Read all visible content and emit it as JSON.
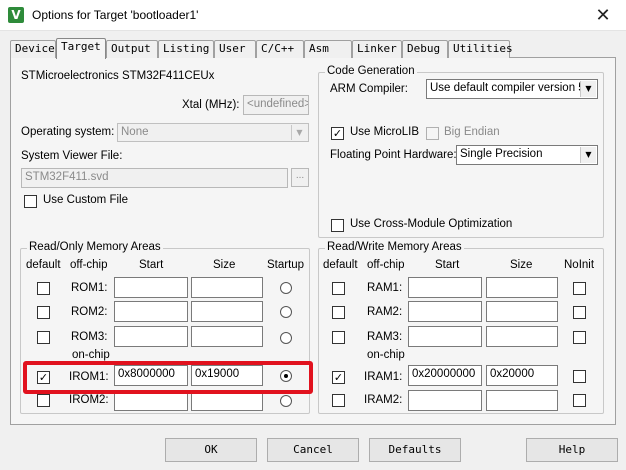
{
  "window": {
    "title": "Options for Target 'bootloader1'",
    "app_icon_glyph": "V",
    "close_glyph": "✕"
  },
  "tabs": [
    {
      "label": "Device"
    },
    {
      "label": "Target"
    },
    {
      "label": "Output"
    },
    {
      "label": "Listing"
    },
    {
      "label": "User"
    },
    {
      "label": "C/C++"
    },
    {
      "label": "Asm"
    },
    {
      "label": "Linker"
    },
    {
      "label": "Debug"
    },
    {
      "label": "Utilities"
    }
  ],
  "active_tab": "Target",
  "device": {
    "name": "STMicroelectronics STM32F411CEUx",
    "xtal_label": "Xtal (MHz):",
    "xtal_value": "<undefined>",
    "os_label": "Operating system:",
    "os_value": "None",
    "svd_label": "System Viewer File:",
    "svd_value": "STM32F411.svd",
    "browse_label": "...",
    "custom_file_label": "Use Custom File",
    "custom_file_checked": false
  },
  "codegen": {
    "title": "Code Generation",
    "compiler_label": "ARM Compiler:",
    "compiler_value": "Use default compiler version 5",
    "microlib_label": "Use MicroLIB",
    "microlib_checked": true,
    "big_endian_label": "Big Endian",
    "big_endian_checked": false,
    "fp_label": "Floating Point Hardware:",
    "fp_value": "Single Precision",
    "cross_module_label": "Use Cross-Module Optimization",
    "cross_module_checked": false
  },
  "rom": {
    "title": "Read/Only Memory Areas",
    "headers": {
      "default": "default",
      "offchip": "off-chip",
      "start": "Start",
      "size": "Size",
      "startup": "Startup"
    },
    "onchip_label": "on-chip",
    "rows": [
      {
        "label": "ROM1:",
        "start": "",
        "size": "",
        "default": false,
        "startup": false
      },
      {
        "label": "ROM2:",
        "start": "",
        "size": "",
        "default": false,
        "startup": false
      },
      {
        "label": "ROM3:",
        "start": "",
        "size": "",
        "default": false,
        "startup": false
      },
      {
        "label": "IROM1:",
        "start": "0x8000000",
        "size": "0x19000",
        "default": true,
        "startup": true
      },
      {
        "label": "IROM2:",
        "start": "",
        "size": "",
        "default": false,
        "startup": false
      }
    ]
  },
  "ram": {
    "title": "Read/Write Memory Areas",
    "headers": {
      "default": "default",
      "offchip": "off-chip",
      "start": "Start",
      "size": "Size",
      "noinit": "NoInit"
    },
    "onchip_label": "on-chip",
    "rows": [
      {
        "label": "RAM1:",
        "start": "",
        "size": "",
        "default": false,
        "noinit": false
      },
      {
        "label": "RAM2:",
        "start": "",
        "size": "",
        "default": false,
        "noinit": false
      },
      {
        "label": "RAM3:",
        "start": "",
        "size": "",
        "default": false,
        "noinit": false
      },
      {
        "label": "IRAM1:",
        "start": "0x20000000",
        "size": "0x20000",
        "default": true,
        "noinit": false
      },
      {
        "label": "IRAM2:",
        "start": "",
        "size": "",
        "default": false,
        "noinit": false
      }
    ]
  },
  "buttons": {
    "ok": "OK",
    "cancel": "Cancel",
    "defaults": "Defaults",
    "help": "Help"
  },
  "glyphs": {
    "check": "✓",
    "dropdown": "▼"
  },
  "colors": {
    "highlight": "#e1121e",
    "app_icon": "#2e8b3a"
  }
}
